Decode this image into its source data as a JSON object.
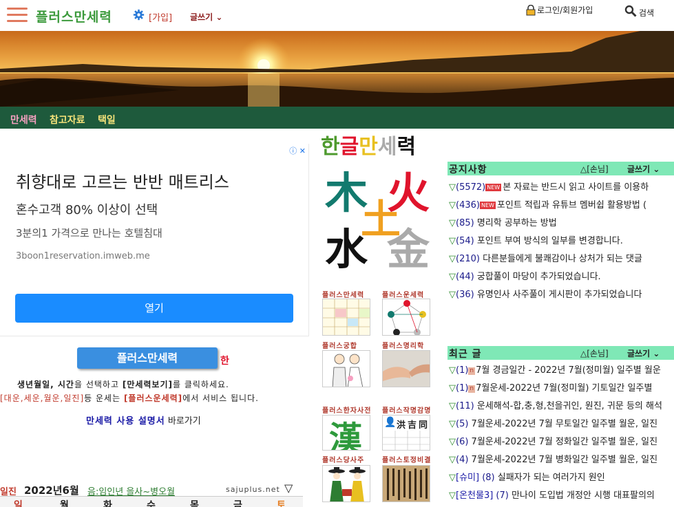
{
  "header": {
    "site_title": "플러스만세력",
    "join": "[가입]",
    "write": "글쓰기",
    "login": "로그인/회원가입",
    "search": "검색"
  },
  "nav": {
    "items": [
      "만세력",
      "참고자료",
      "택일"
    ]
  },
  "ad": {
    "title": "취향대로 고르는 반반 매트리스",
    "subtitle": "혼수고객 80% 이상이 선택",
    "description": "3분의1 가격으로 만나는 호텔침대",
    "url": "3boon1reservation.imweb.me",
    "button": "열기"
  },
  "manse": {
    "button": "플러스만세력",
    "han": "한",
    "instruction1_pre": "생년월일, 시간",
    "instruction1_mid": "을 선택하고 ",
    "instruction1_bold": "[만세력보기]",
    "instruction1_post": "를 클릭하세요.",
    "instruction2_red": "[대운,세운,월운,일진]",
    "instruction2_mid": "등 운세는 ",
    "instruction2_bold": "[플러스운세력]",
    "instruction2_post": "에서 서비스 됩니다.",
    "guide_link": "만세력 사용 설명서",
    "guide_text": " 바로가기"
  },
  "calendar": {
    "left_label": "일진",
    "month": "2022년6월",
    "lunar": "음:임인년 을사~병오월",
    "site": "sajuplus.net",
    "days": [
      "일",
      "월",
      "화",
      "수",
      "목",
      "금",
      "토"
    ]
  },
  "middle": {
    "hangeul_title_chars": [
      "한",
      "글",
      "만",
      "세",
      "력"
    ],
    "elements": {
      "wood": "木",
      "fire": "火",
      "earth": "土",
      "water": "水",
      "metal": "金"
    },
    "thumbs": [
      {
        "label": "플러스만세력"
      },
      {
        "label": "플러스운세력"
      },
      {
        "label": "플러스궁합"
      },
      {
        "label": "플러스명리학"
      },
      {
        "label": "플러스한자사전"
      },
      {
        "label": "플러스작명감명"
      },
      {
        "label": "플러스당사주"
      },
      {
        "label": "플러스토정비결"
      }
    ],
    "hanja_char": "漢",
    "name_chars": [
      "洪",
      "吉",
      "同"
    ]
  },
  "notice": {
    "title": "공지사항",
    "guest": "△[손님]",
    "write": "글쓰기",
    "posts": [
      {
        "count": "(5572)",
        "new": true,
        "text": "본 자료는 반드시 읽고 사이트를 이용하"
      },
      {
        "count": "(436)",
        "new": true,
        "text": "포인트 적립과 유튜브 멤버쉽 활용방법 ("
      },
      {
        "count": "(85)",
        "new": false,
        "text": " 명리학 공부하는 방법"
      },
      {
        "count": "(54)",
        "new": false,
        "text": " 포인트 부여 방식의 일부를 변경합니다."
      },
      {
        "count": "(210)",
        "new": false,
        "text": " 다른분들에게 불쾌감이나 상처가 되는 댓글"
      },
      {
        "count": "(44)",
        "new": false,
        "text": " 궁합풀이 마당이 추가되었습니다."
      },
      {
        "count": "(36)",
        "new": false,
        "text": " 유명인사 사주풀이 게시판이 추가되었습니다"
      }
    ]
  },
  "recent": {
    "title": "최근 글",
    "guest": "△[손님]",
    "write": "글쓰기",
    "posts": [
      {
        "tag": "",
        "count": "(1)",
        "n": true,
        "text": "7월 경금일간 - 2022년 7월(정미월) 일주별 월운"
      },
      {
        "tag": "",
        "count": "(1)",
        "n": true,
        "text": "7월운세-2022년 7월(정미월) 기토일간 일주별"
      },
      {
        "tag": "",
        "count": "(11)",
        "n": false,
        "text": " 운세해석-합,충,형,천을귀인, 원진, 귀문 등의 해석"
      },
      {
        "tag": "",
        "count": "(5)",
        "n": false,
        "text": " 7월운세-2022년 7월 무토일간 일주별 월운, 일진"
      },
      {
        "tag": "",
        "count": "(6)",
        "n": false,
        "text": " 7월운세-2022년 7월 정화일간 일주별 월운, 일진"
      },
      {
        "tag": "",
        "count": "(4)",
        "n": false,
        "text": " 7월운세-2022년 7월 병화일간 일주별 월운, 일진"
      },
      {
        "tag": "[슈미]",
        "count": " (8)",
        "n": false,
        "text": " 실패자가 되는 여러가지 원인"
      },
      {
        "tag": "[온천물3]",
        "count": " (7)",
        "n": false,
        "text": " 만나이 도입법 개정안 시행 대표팔의의"
      }
    ]
  },
  "colors": {
    "nav_bg": "#1e5a3c",
    "box_head": "#7fe8b6",
    "title_green": "#3c9a3c",
    "ad_button": "#1a8cff",
    "manse_button": "#3a8fe0"
  }
}
